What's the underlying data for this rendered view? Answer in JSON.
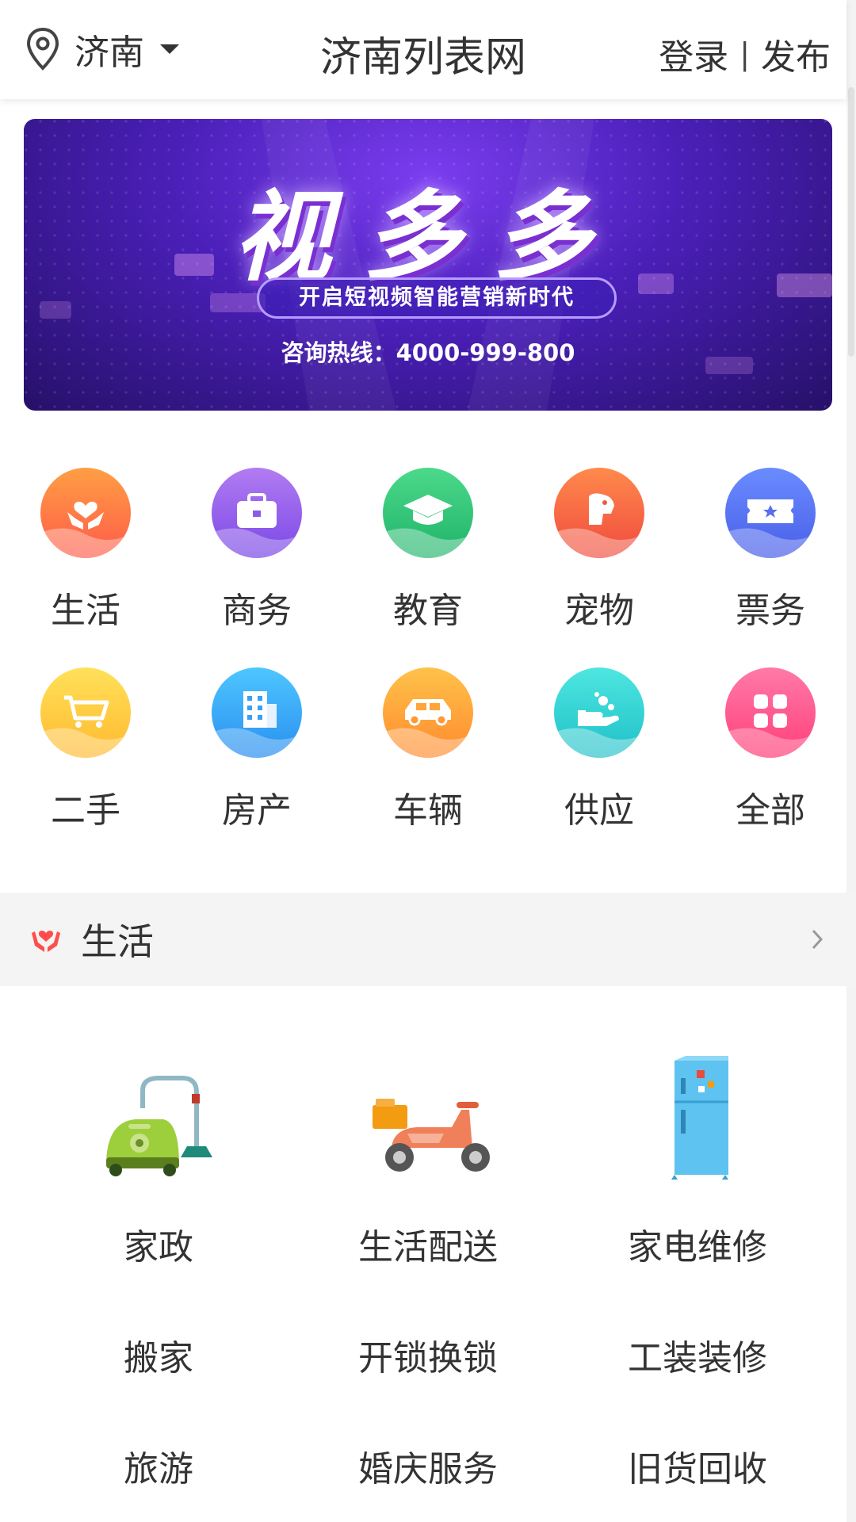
{
  "header": {
    "city": "济南",
    "title": "济南列表网",
    "login": "登录",
    "separator": "|",
    "publish": "发布"
  },
  "banner": {
    "title": "视多多",
    "tagline": "开启短视频智能营销新时代",
    "hotline": "咨询热线：4000-999-800"
  },
  "categories": [
    {
      "label": "生活",
      "icon": "heart-hands-icon",
      "color_top": "#ff9a3c",
      "color_bottom": "#ff4d4d"
    },
    {
      "label": "商务",
      "icon": "briefcase-icon",
      "color_top": "#b27cf2",
      "color_bottom": "#7a48e6"
    },
    {
      "label": "教育",
      "icon": "graduation-cap-icon",
      "color_top": "#4cd98a",
      "color_bottom": "#1fb36a"
    },
    {
      "label": "宠物",
      "icon": "dog-icon",
      "color_top": "#ff8a4c",
      "color_bottom": "#f04a3e"
    },
    {
      "label": "票务",
      "icon": "ticket-icon",
      "color_top": "#6a8cff",
      "color_bottom": "#4a5fe8"
    },
    {
      "label": "二手",
      "icon": "cart-icon",
      "color_top": "#ffe15a",
      "color_bottom": "#ffb92e"
    },
    {
      "label": "房产",
      "icon": "building-icon",
      "color_top": "#4ec6ff",
      "color_bottom": "#2a8ff0"
    },
    {
      "label": "车辆",
      "icon": "car-icon",
      "color_top": "#ffc24a",
      "color_bottom": "#ff8a2e"
    },
    {
      "label": "供应",
      "icon": "hand-supply-icon",
      "color_top": "#4ee6e0",
      "color_bottom": "#1fc0c8"
    },
    {
      "label": "全部",
      "icon": "grid-icon",
      "color_top": "#ff7aa8",
      "color_bottom": "#ff3f7a"
    }
  ],
  "section": {
    "title": "生活"
  },
  "services": [
    {
      "label": "家政",
      "icon": "vacuum-cleaner-icon"
    },
    {
      "label": "生活配送",
      "icon": "scooter-icon"
    },
    {
      "label": "家电维修",
      "icon": "refrigerator-icon"
    },
    {
      "label": "搬家"
    },
    {
      "label": "开锁换锁"
    },
    {
      "label": "工装装修"
    },
    {
      "label": "旅游"
    },
    {
      "label": "婚庆服务"
    },
    {
      "label": "旧货回收"
    }
  ]
}
